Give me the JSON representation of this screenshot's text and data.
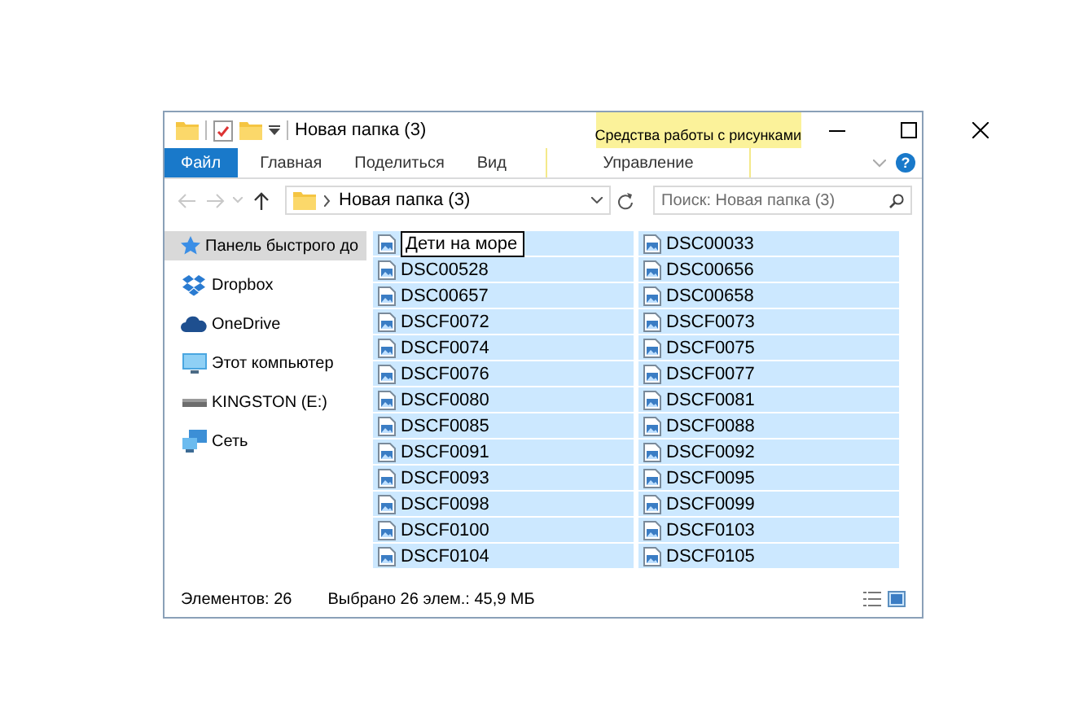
{
  "window": {
    "title": "Новая папка (3)"
  },
  "ribbon": {
    "context_group": "Средства работы с рисунками",
    "tabs": [
      {
        "label": "Файл",
        "kind": "file",
        "selected": false
      },
      {
        "label": "Главная",
        "kind": "normal",
        "selected": false
      },
      {
        "label": "Поделиться",
        "kind": "normal",
        "selected": false
      },
      {
        "label": "Вид",
        "kind": "normal",
        "selected": false
      },
      {
        "label": "Управление",
        "kind": "context",
        "selected": false
      }
    ],
    "help": "?"
  },
  "address": {
    "path": "Новая папка (3)"
  },
  "search": {
    "placeholder": "Поиск: Новая папка (3)"
  },
  "nav": [
    {
      "label": "Панель быстрого до",
      "kind": "star",
      "selected": true
    },
    {
      "label": "Dropbox",
      "kind": "dropbox",
      "selected": false
    },
    {
      "label": "OneDrive",
      "kind": "cloud",
      "selected": false
    },
    {
      "label": "Этот компьютер",
      "kind": "computer",
      "selected": false
    },
    {
      "label": "KINGSTON (E:)",
      "kind": "drive",
      "selected": false
    },
    {
      "label": "Сеть",
      "kind": "network",
      "selected": false
    }
  ],
  "files": [
    {
      "name": "Дети на море",
      "selected": true,
      "editing": true
    },
    {
      "name": "DSC00528",
      "selected": true,
      "editing": false
    },
    {
      "name": "DSC00657",
      "selected": true,
      "editing": false
    },
    {
      "name": "DSCF0072",
      "selected": true,
      "editing": false
    },
    {
      "name": "DSCF0074",
      "selected": true,
      "editing": false
    },
    {
      "name": "DSCF0076",
      "selected": true,
      "editing": false
    },
    {
      "name": "DSCF0080",
      "selected": true,
      "editing": false
    },
    {
      "name": "DSCF0085",
      "selected": true,
      "editing": false
    },
    {
      "name": "DSCF0091",
      "selected": true,
      "editing": false
    },
    {
      "name": "DSCF0093",
      "selected": true,
      "editing": false
    },
    {
      "name": "DSCF0098",
      "selected": true,
      "editing": false
    },
    {
      "name": "DSCF0100",
      "selected": true,
      "editing": false
    },
    {
      "name": "DSCF0104",
      "selected": true,
      "editing": false
    },
    {
      "name": "DSC00033",
      "selected": true,
      "editing": false
    },
    {
      "name": "DSC00656",
      "selected": true,
      "editing": false
    },
    {
      "name": "DSC00658",
      "selected": true,
      "editing": false
    },
    {
      "name": "DSCF0073",
      "selected": true,
      "editing": false
    },
    {
      "name": "DSCF0075",
      "selected": true,
      "editing": false
    },
    {
      "name": "DSCF0077",
      "selected": true,
      "editing": false
    },
    {
      "name": "DSCF0081",
      "selected": true,
      "editing": false
    },
    {
      "name": "DSCF0088",
      "selected": true,
      "editing": false
    },
    {
      "name": "DSCF0092",
      "selected": true,
      "editing": false
    },
    {
      "name": "DSCF0095",
      "selected": true,
      "editing": false
    },
    {
      "name": "DSCF0099",
      "selected": true,
      "editing": false
    },
    {
      "name": "DSCF0103",
      "selected": true,
      "editing": false
    },
    {
      "name": "DSCF0105",
      "selected": true,
      "editing": false
    }
  ],
  "status_bar": {
    "count": "Элементов: 26",
    "selection": "Выбрано 26 элем.: 45,9 МБ"
  }
}
